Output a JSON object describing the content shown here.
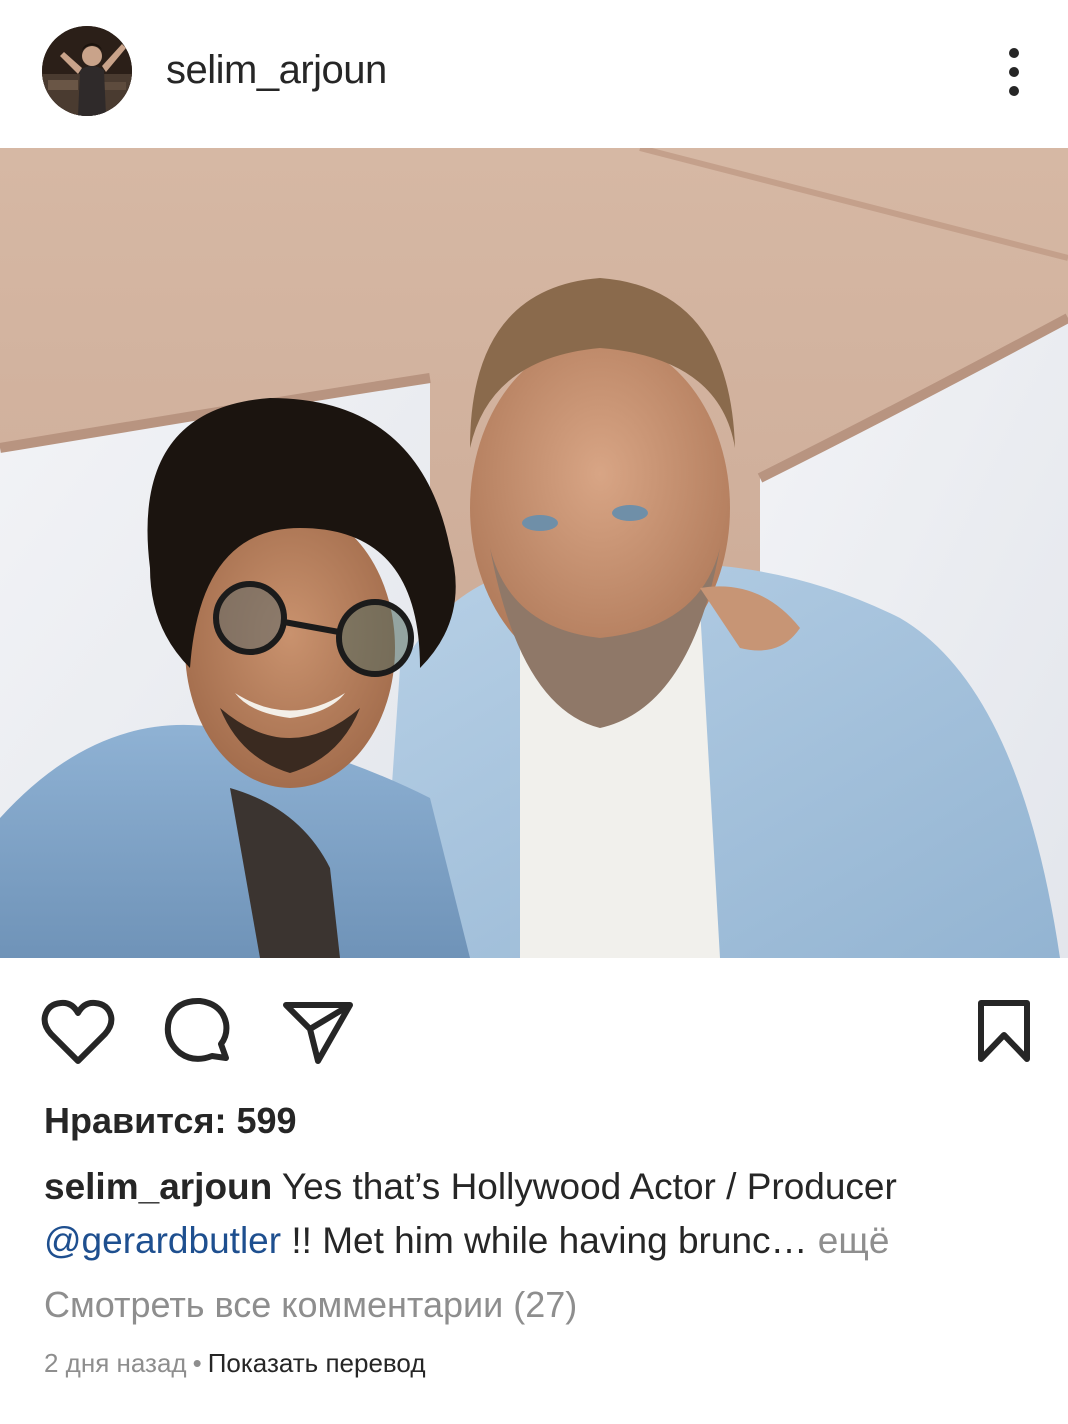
{
  "header": {
    "username": "selim_arjoun",
    "avatar_icon": "user-avatar",
    "more_icon": "vertical-ellipsis-icon"
  },
  "photo": {
    "icon": "post-photo"
  },
  "actions": {
    "like_icon": "heart-icon",
    "comment_icon": "comment-bubble-icon",
    "share_icon": "paper-plane-icon",
    "save_icon": "bookmark-icon"
  },
  "likes": {
    "text": "Нравится: 599"
  },
  "caption": {
    "username": "selim_arjoun",
    "text_part1": " Yes that’s Hollywood Actor / Producer ",
    "mention": "@gerardbutler",
    "text_part2": " !! Met him while having brunc",
    "ellipsis": "…",
    "more_label": " ещё"
  },
  "comments": {
    "view_all": "Смотреть все комментарии (27)"
  },
  "meta": {
    "time_ago": "2 дня назад",
    "separator": "•",
    "translate": "Показать перевод"
  },
  "colors": {
    "text": "#262626",
    "secondary": "#8e8e8e",
    "mention": "#1e4f8f",
    "background": "#ffffff"
  }
}
